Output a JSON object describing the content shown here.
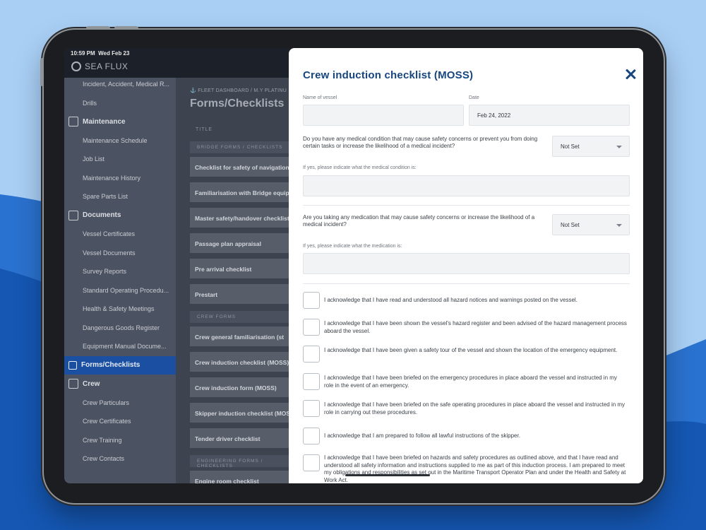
{
  "status": {
    "time": "10:59 PM",
    "date": "Wed Feb 23"
  },
  "brand": {
    "name": "SEA FLUX"
  },
  "sidebar": {
    "items": [
      {
        "label": "Incident, Accident, Medical R...",
        "type": "item"
      },
      {
        "label": "Drills",
        "type": "item"
      },
      {
        "label": "Maintenance",
        "type": "section",
        "icon": "tools-icon"
      },
      {
        "label": "Maintenance Schedule",
        "type": "item"
      },
      {
        "label": "Job List",
        "type": "item"
      },
      {
        "label": "Maintenance History",
        "type": "item"
      },
      {
        "label": "Spare Parts List",
        "type": "item"
      },
      {
        "label": "Documents",
        "type": "section",
        "icon": "document-icon"
      },
      {
        "label": "Vessel Certificates",
        "type": "item"
      },
      {
        "label": "Vessel Documents",
        "type": "item"
      },
      {
        "label": "Survey Reports",
        "type": "item"
      },
      {
        "label": "Standard Operating Procedu...",
        "type": "item"
      },
      {
        "label": "Health & Safety Meetings",
        "type": "item"
      },
      {
        "label": "Dangerous Goods Register",
        "type": "item"
      },
      {
        "label": "Equipment Manual Docume...",
        "type": "item"
      },
      {
        "label": "Forms/Checklists",
        "type": "active",
        "icon": "checkbox-icon"
      },
      {
        "label": "Crew",
        "type": "section",
        "icon": "people-icon"
      },
      {
        "label": "Crew Particulars",
        "type": "item"
      },
      {
        "label": "Crew Certificates",
        "type": "item"
      },
      {
        "label": "Crew Training",
        "type": "item"
      },
      {
        "label": "Crew Contacts",
        "type": "item"
      }
    ]
  },
  "main": {
    "breadcrumb": "⚓ FLEET DASHBOARD / M.Y PLATINU",
    "title": "Forms/Checklists",
    "column_title": "TITLE",
    "groups": [
      {
        "category": "BRIDGE FORMS / CHECKLISTS",
        "rows": [
          "Checklist for safety of navigation",
          "Familiarisation with Bridge equipment",
          "Master safety/handover checklist",
          "Passage plan appraisal",
          "Pre arrival checklist",
          "Prestart"
        ]
      },
      {
        "category": "CREW FORMS",
        "rows": [
          "Crew general familiarisation (st",
          "Crew induction checklist (MOSS)",
          "Crew induction form (MOSS)",
          "Skipper induction checklist (MOSS",
          "Tender driver checklist"
        ]
      },
      {
        "category": "ENGINEERING FORMS / CHECKLISTS",
        "rows": [
          "Engine room checklist"
        ]
      }
    ]
  },
  "modal": {
    "title": "Crew induction checklist (MOSS)",
    "vessel_label": "Name of vessel",
    "vessel_value": "",
    "date_label": "Date",
    "date_value": "Feb 24, 2022",
    "q1": "Do you have any medical condition that may cause safety concerns or prevent you from doing certain tasks or increase the likelihood of a medical incident?",
    "q1_value": "Not Set",
    "q1_follow_label": "If yes, please indicate what the medical condition is:",
    "q2": "Are you taking any medication that may cause safety concerns or increase the likelihood of a medical incident?",
    "q2_value": "Not Set",
    "q2_follow_label": "If yes, please indicate what the medication is:",
    "acks": [
      "I acknowledge that I have read and understood all hazard notices and warnings posted on the vessel.",
      "I acknowledge that I have been shown the vessel's hazard register and been advised of the hazard management process aboard the vessel.",
      "I acknowledge that I have been given a safety tour of the vessel and shown the location of the emergency equipment.",
      "I acknowledge that I have been briefed on the emergency procedures in place aboard the vessel and instructed in my role in the event of an emergency.",
      "I acknowledge that I have been briefed on the safe operating procedures in place aboard the vessel and instructed in my role in carrying out these procedures.",
      "I acknowledge that I am prepared to follow all lawful instructions of the skipper.",
      "I acknowledge that I have been briefed on hazards and safety procedures as outlined above, and that I have read and understood all safety information and instructions supplied to me as part of this induction process. I am prepared to meet my obligations and responsibilities as set out in the Maritime Transport Operator Plan and under the Health and Safety at Work Act."
    ]
  },
  "colors": {
    "accent": "#17467f",
    "active_nav": "#1a4fa1",
    "background": "#a9cff5",
    "wave": "#1e63bd"
  }
}
